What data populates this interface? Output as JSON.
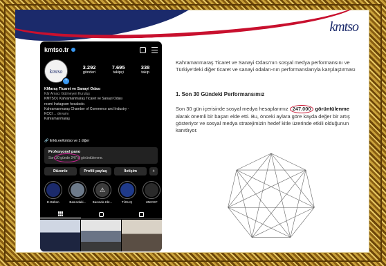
{
  "slide": {
    "logo_text": "kmtso"
  },
  "profile": {
    "username": "kmtso.tr",
    "stats": [
      {
        "value": "3.292",
        "label": "gönderi"
      },
      {
        "value": "7.695",
        "label": "takipçi"
      },
      {
        "value": "338",
        "label": "takip"
      }
    ],
    "name": "KMaraş Ticaret ve Sanayi Odası",
    "bio_lines": [
      "Kâr Amacı Gütmeyen Kuruluş",
      "KMTSO | Kahramanmaraş Ticaret ve Sanayi Odası",
      "resmi Instagram hesabıdır.",
      "Kahramanmaraş Chamber of Commerce and Industry -",
      "KCCI"
    ],
    "bio_more": "... devamı",
    "location": "Kahramanmaraş",
    "link_text": "linktr.ee/kmtso ve 1 diğer",
    "pro_title": "Profesyonel pano",
    "pro_subtitle": "Son 30 günde 247 B görüntülenme.",
    "buttons": [
      "Düzenle",
      "Profili paylaş",
      "İletişim"
    ],
    "highlights": [
      {
        "label": "E-Bülten",
        "color": "#1b2a6b"
      },
      {
        "label": "Basındaki...",
        "color": "#6d7a8a"
      },
      {
        "label": "Basında Kkt...",
        "color": "#3b3b3b"
      },
      {
        "label": "TÜSAŞ",
        "color": "#1f3a8a"
      },
      {
        "label": "UNICEF",
        "color": "#2a2a2a"
      }
    ]
  },
  "content": {
    "intro": "Kahramanmaraş Ticaret ve Sanayi Odası'nın sosyal medya performansını ve Türkiye'deki diğer ticaret ve sanayi odaları-nın performanslarıyla karşılaştırması",
    "section_title": "1. Son 30 Gündeki Performansımız",
    "para_before": "Son 30 gün içerisinde sosyal medya hesaplarımız",
    "para_highlight": "247.000",
    "para_strong": "görüntülenme",
    "para_after": "alarak önemli bir başarı elde etti. Bu, önceki aylara göre kayda değer bir artış gösteriyor ve sosyal medya stratejimizin hedef kitle üzerinde etkili olduğunun kanıtlıyor."
  },
  "colors": {
    "navy": "#1b2a6b",
    "red": "#c8102e",
    "gold": "#c9a13a",
    "instagram_blue": "#3897f0",
    "highlight_magenta": "#d6219b"
  }
}
